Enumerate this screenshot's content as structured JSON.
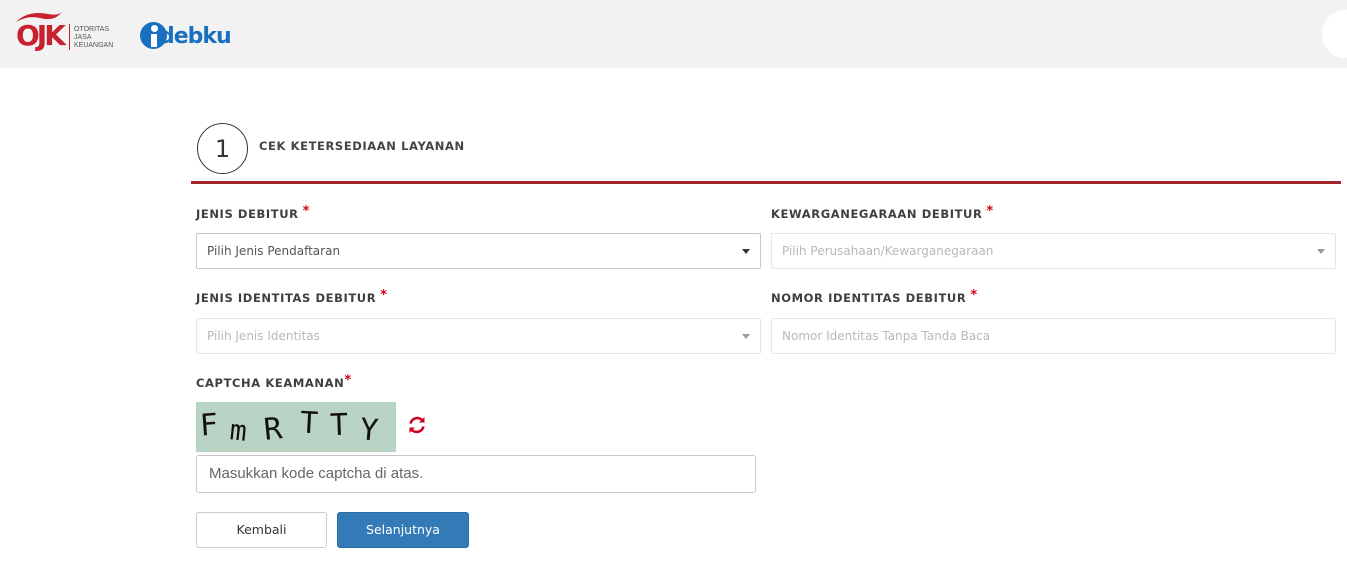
{
  "header": {
    "ojk_logo_text": "OJK",
    "ojk_sub_lines": [
      "OTORITAS",
      "JASA",
      "KEUANGAN"
    ],
    "idebku_text": "debku",
    "brand_red": "#c8202f",
    "brand_blue": "#1a70c0"
  },
  "step": {
    "number": "1",
    "title": "CEK KETERSEDIAAN LAYANAN"
  },
  "form": {
    "required_mark": "*",
    "jenis_debitur": {
      "label": "JENIS DEBITUR",
      "value": "Pilih Jenis Pendaftaran"
    },
    "kewarganegaraan": {
      "label": "KEWARGANEGARAAN DEBITUR",
      "value": "Pilih Perusahaan/Kewarganegaraan"
    },
    "jenis_identitas": {
      "label": "JENIS IDENTITAS DEBITUR",
      "value": "Pilih Jenis Identitas"
    },
    "nomor_identitas": {
      "label": "NOMOR IDENTITAS DEBITUR",
      "placeholder": "Nomor Identitas Tanpa Tanda Baca"
    },
    "captcha": {
      "label": "CAPTCHA KEAMANAN",
      "chars": [
        "F",
        "m",
        "R",
        "T",
        "T",
        "Y"
      ],
      "input_placeholder": "Masukkan kode captcha di atas."
    }
  },
  "buttons": {
    "back_label": "Kembali",
    "next_label": "Selanjutnya",
    "accent": "#337ab7"
  }
}
